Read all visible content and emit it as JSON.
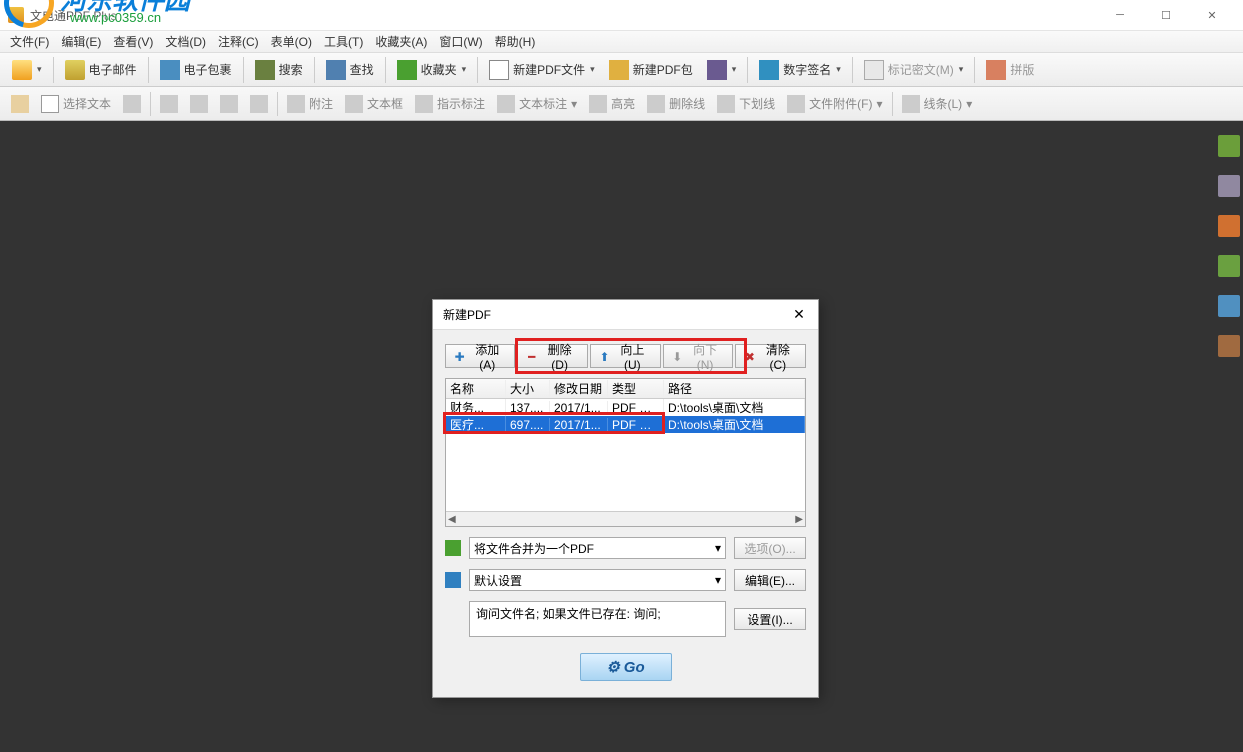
{
  "app": {
    "title": "文电通PDF Plus"
  },
  "menubar": [
    "文件(F)",
    "编辑(E)",
    "查看(V)",
    "文档(D)",
    "注释(C)",
    "表单(O)",
    "工具(T)",
    "收藏夹(A)",
    "窗口(W)",
    "帮助(H)"
  ],
  "toolbar1": {
    "open": "",
    "mail_label": "电子邮件",
    "pkg_label": "电子包裹",
    "search_label": "搜索",
    "find_label": "查找",
    "fav_label": "收藏夹",
    "newpdf_label": "新建PDF文件",
    "newpack_label": "新建PDF包",
    "sign_label": "数字签名",
    "mark_label": "标记密文(M)",
    "split_label": "拼版"
  },
  "toolbar2": {
    "select_label": "选择文本",
    "attach_label": "附注",
    "textbox_label": "文本框",
    "callout_label": "指示标注",
    "textmark_label": "文本标注",
    "highlight_label": "高亮",
    "strike_label": "删除线",
    "underline_label": "下划线",
    "fileattach_label": "文件附件(F)",
    "line_label": "线条(L)"
  },
  "watermark": {
    "text1": "河东软件园",
    "text2": "www.pc0359.cn"
  },
  "dialog": {
    "title": "新建PDF",
    "buttons": {
      "add": "添加(A)",
      "del": "删除(D)",
      "up": "向上(U)",
      "down": "向下(N)",
      "clear": "清除(C)"
    },
    "table": {
      "headers": {
        "name": "名称",
        "size": "大小",
        "date": "修改日期",
        "type": "类型",
        "path": "路径"
      },
      "rows": [
        {
          "name": "财务...",
          "size": "137....",
          "date": "2017/1...",
          "type": "PDF 文件",
          "path": "D:\\tools\\桌面\\文档",
          "selected": false
        },
        {
          "name": "医疗...",
          "size": "697....",
          "date": "2017/1...",
          "type": "PDF 文件",
          "path": "D:\\tools\\桌面\\文档",
          "selected": true
        }
      ]
    },
    "merge_select": "将文件合并为一个PDF",
    "options_btn": "选项(O)...",
    "preset_select": "默认设置",
    "edit_btn": "编辑(E)...",
    "ask_text": "询问文件名; 如果文件已存在: 询问;",
    "settings_btn": "设置(I)...",
    "go": "Go"
  }
}
